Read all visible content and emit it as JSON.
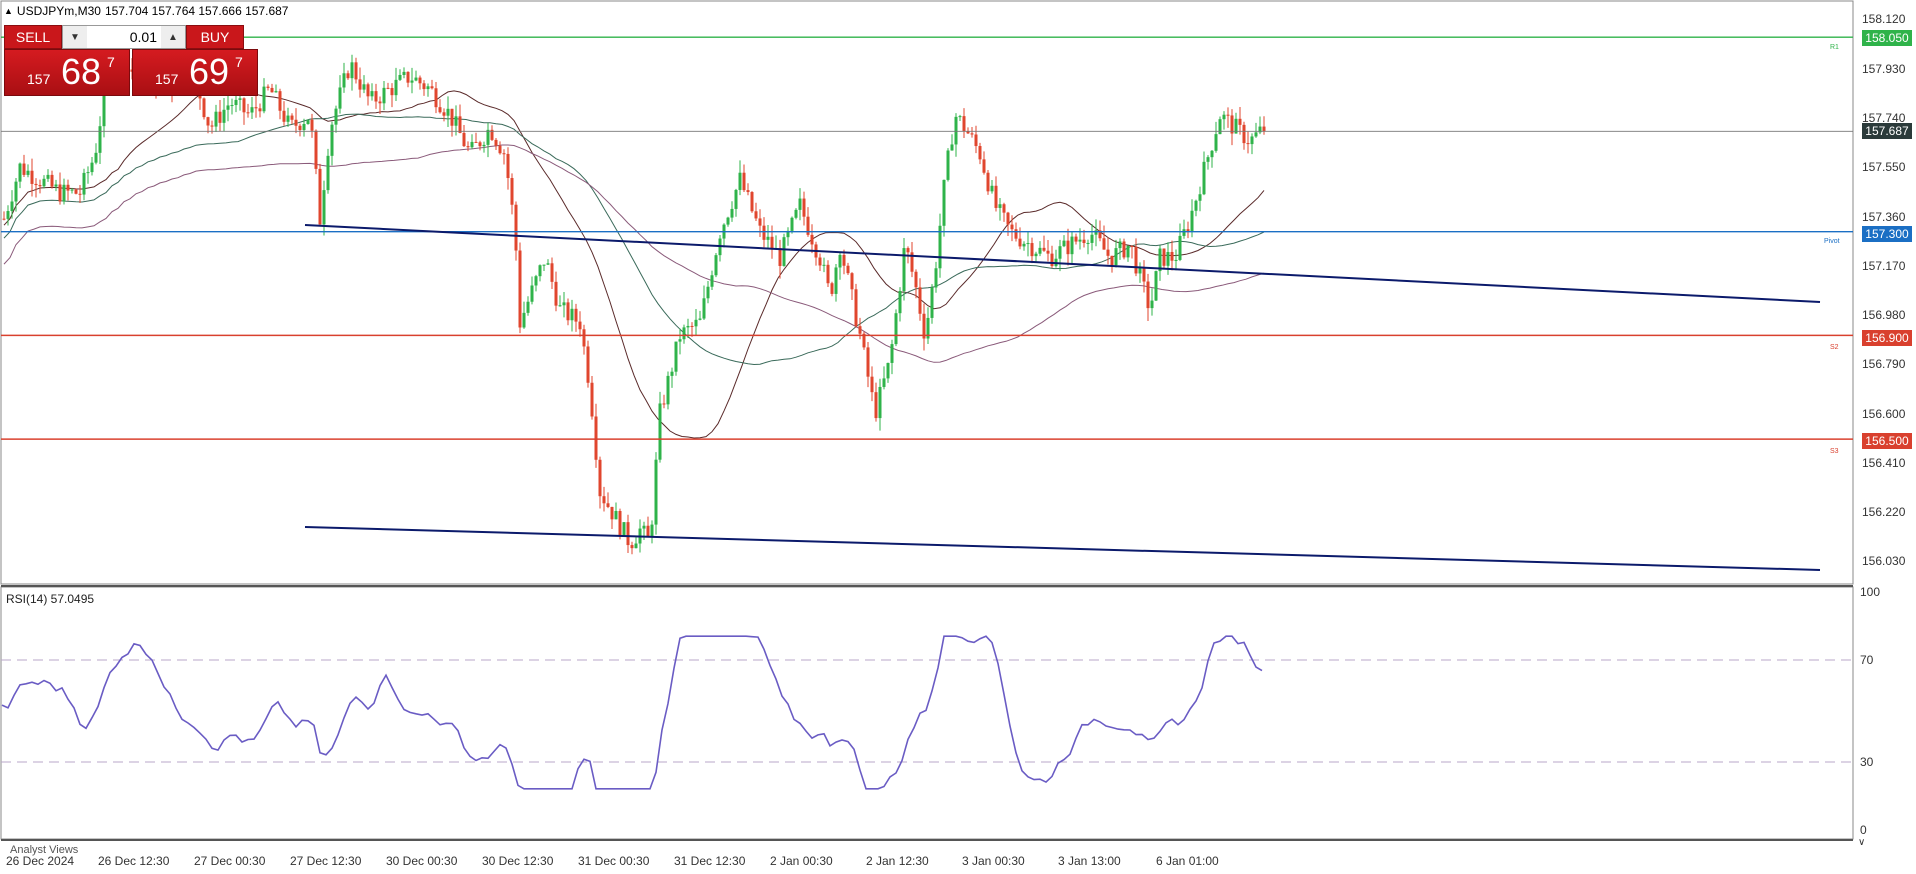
{
  "header": {
    "symbol_info": "USDJPYm,M30",
    "ohlc": "157.704 157.764 157.666 157.687"
  },
  "trade_panel": {
    "sell_label": "SELL",
    "buy_label": "BUY",
    "lot_value": "0.01",
    "sell_price": {
      "prefix": "157",
      "big": "68",
      "sup": "7"
    },
    "buy_price": {
      "prefix": "157",
      "big": "69",
      "sup": "7"
    }
  },
  "price_axis": {
    "ticks": [
      "158.120",
      "157.930",
      "157.740",
      "157.550",
      "157.360",
      "157.170",
      "156.980",
      "156.790",
      "156.600",
      "156.410",
      "156.220",
      "156.030"
    ],
    "current_price": "157.687",
    "levels": [
      {
        "name": "R1",
        "value": "158.050",
        "color": "#2fb34a"
      },
      {
        "name": "Pivot",
        "value": "157.300",
        "color": "#1b6fc4"
      },
      {
        "name": "S2",
        "value": "156.900",
        "color": "#d9402e"
      },
      {
        "name": "S3",
        "value": "156.500",
        "color": "#d9402e"
      }
    ]
  },
  "rsi": {
    "label": "RSI(14) 57.0495",
    "ticks": [
      "100",
      "70",
      "30",
      "0"
    ]
  },
  "time_axis": [
    "26 Dec 2024",
    "26 Dec 12:30",
    "27 Dec 00:30",
    "27 Dec 12:30",
    "30 Dec 00:30",
    "30 Dec 12:30",
    "31 Dec 00:30",
    "31 Dec 12:30",
    "2 Jan 00:30",
    "2 Jan 12:30",
    "3 Jan 00:30",
    "3 Jan 13:00",
    "6 Jan 01:00"
  ],
  "footer": {
    "analyst_tab": "Analyst Views"
  },
  "colors": {
    "bull": "#2fb34a",
    "bear": "#e0462e",
    "rsi_line": "#6a5cc4",
    "trendline": "#0b1a6b"
  }
}
